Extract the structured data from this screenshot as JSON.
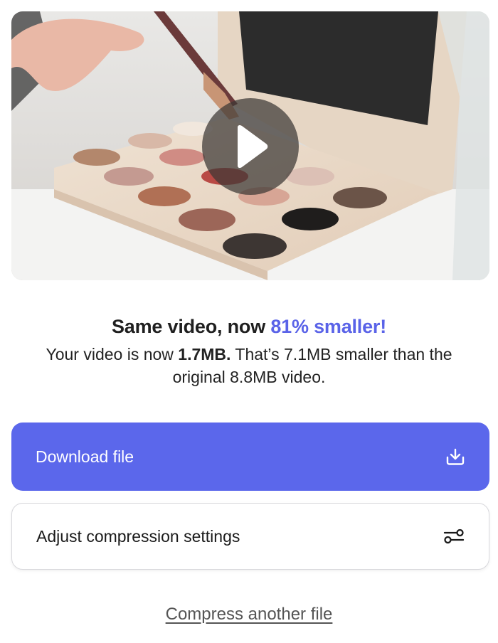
{
  "video": {
    "play_label": "play-icon"
  },
  "result": {
    "headline_prefix": "Same video, now ",
    "headline_accent": "81% smaller!",
    "summary_1": "Your video is now ",
    "summary_size": "1.7MB.",
    "summary_2": " That’s 7.1MB smaller than the original 8.8MB video."
  },
  "actions": {
    "download_label": "Download file",
    "download_icon": "download-icon",
    "adjust_label": "Adjust compression settings",
    "adjust_icon": "sliders-icon",
    "another_label": "Compress another file"
  },
  "colors": {
    "accent": "#5a63e8",
    "primary_button": "#5b67eb"
  }
}
